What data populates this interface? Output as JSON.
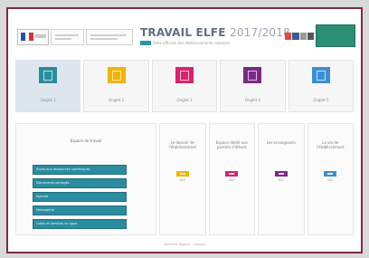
{
  "header": {
    "title": "TRAVAIL ELFE",
    "title_year": "2017/2018",
    "subtitle": "Sites officiels des établissements scolaires",
    "logo_text": "",
    "banner_text": "",
    "share_colors": [
      "#e5483f",
      "#3b5998",
      "#999999",
      "#555555"
    ]
  },
  "tabs": [
    {
      "label": "Onglet 1",
      "color": "#2a8d9f",
      "active": true
    },
    {
      "label": "Onglet 2",
      "color": "#f2b400",
      "active": false
    },
    {
      "label": "Onglet 3",
      "color": "#d6246e",
      "active": false
    },
    {
      "label": "Onglet 4",
      "color": "#7a2a85",
      "active": false
    },
    {
      "label": "Onglet 5",
      "color": "#3d8fd1",
      "active": false
    }
  ],
  "left_panel": {
    "title": "Espace de travail",
    "buttons": [
      "Accès aux ressources numériques",
      "Documents partagés",
      "Agenda",
      "Messagerie",
      "Outils et services en ligne"
    ]
  },
  "columns": [
    {
      "title": "Le dossier de l'établissement",
      "chip_color": "#f2b400",
      "chip_label": "Voir"
    },
    {
      "title": "Espace dédié aux parents d'élèves",
      "chip_color": "#d6246e",
      "chip_label": "Voir"
    },
    {
      "title": "Les enseignants",
      "chip_color": "#7a2a85",
      "chip_label": "Voir"
    },
    {
      "title": "La vie de l'établissement",
      "chip_color": "#3d8fd1",
      "chip_label": "Voir"
    }
  ],
  "footer": "Mentions légales · Contact"
}
